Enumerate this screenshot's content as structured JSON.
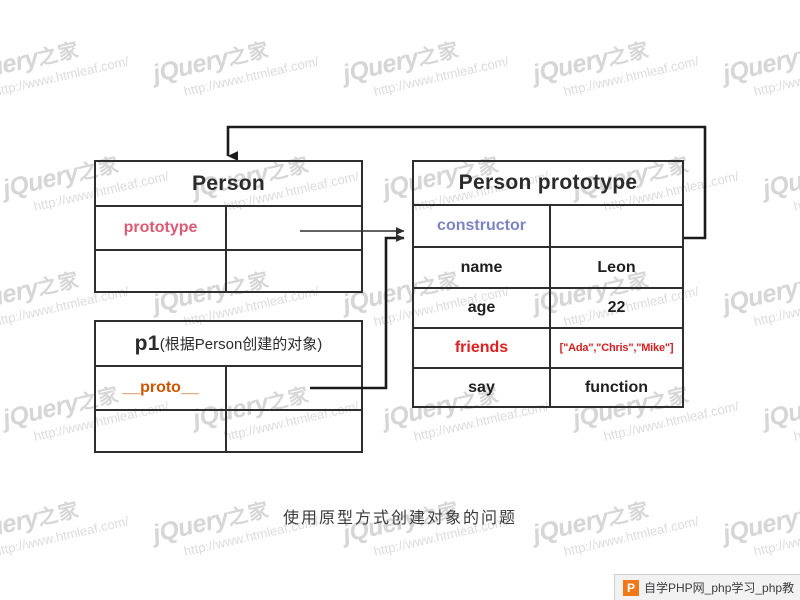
{
  "diagram": {
    "caption": "使用原型方式创建对象的问题",
    "person_table": {
      "title": "Person",
      "rows": [
        {
          "key": "prototype",
          "value": ""
        },
        {
          "key": "",
          "value": ""
        }
      ]
    },
    "p1_table": {
      "title_main": "p1",
      "title_sub": "(根据Person创建的对象)",
      "rows": [
        {
          "key": "__proto__",
          "value": ""
        },
        {
          "key": "",
          "value": ""
        }
      ]
    },
    "prototype_table": {
      "title": "Person prototype",
      "rows": [
        {
          "key": "constructor",
          "value": ""
        },
        {
          "key": "name",
          "value": "Leon"
        },
        {
          "key": "age",
          "value": "22"
        },
        {
          "key": "friends",
          "value": "[\"Ada\",\"Chris\",\"Mike\"]"
        },
        {
          "key": "say",
          "value": "function"
        }
      ]
    },
    "colors": {
      "prototype_key": "#dd5a74",
      "proto_key": "#cc5500",
      "constructor_key": "#7b84c4",
      "friends_key": "#e02020",
      "friends_value": "#d42020",
      "stroke": "#2e2e2e"
    }
  },
  "watermark": {
    "brand": "jQuery",
    "brand_cjk": "之家",
    "url": "http://www.htmleaf.com/"
  },
  "badge": {
    "logo_letter": "P",
    "text": "自学PHP网_php学习_php教"
  }
}
